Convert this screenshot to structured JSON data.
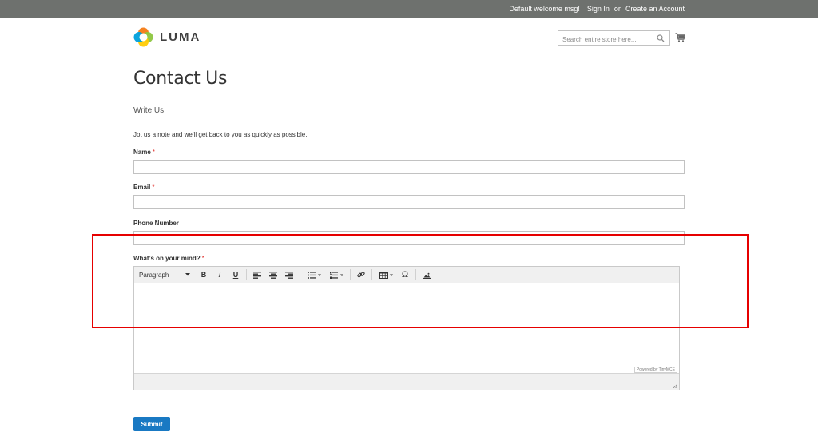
{
  "header": {
    "welcome": "Default welcome msg!",
    "sign_in": "Sign In",
    "or": "or",
    "create_account": "Create an Account"
  },
  "logo": {
    "text": "LUMA"
  },
  "search": {
    "placeholder": "Search entire store here..."
  },
  "page": {
    "title": "Contact Us"
  },
  "form": {
    "legend": "Write Us",
    "intro": "Jot us a note and we’ll get back to you as quickly as possible.",
    "name_label": "Name",
    "email_label": "Email",
    "phone_label": "Phone Number",
    "comment_label": "What’s on your mind?",
    "required_mark": "*",
    "submit_label": "Submit"
  },
  "editor": {
    "format_value": "Paragraph",
    "bold_label": "B",
    "italic_label": "I",
    "underline_label": "U",
    "special_char_label": "Ω",
    "powered_by": "Powered by TinyMCE"
  },
  "colors": {
    "topbar": "#6e716e",
    "primary_button": "#1979c3",
    "required": "#e02b27",
    "highlight": "#e60000"
  }
}
